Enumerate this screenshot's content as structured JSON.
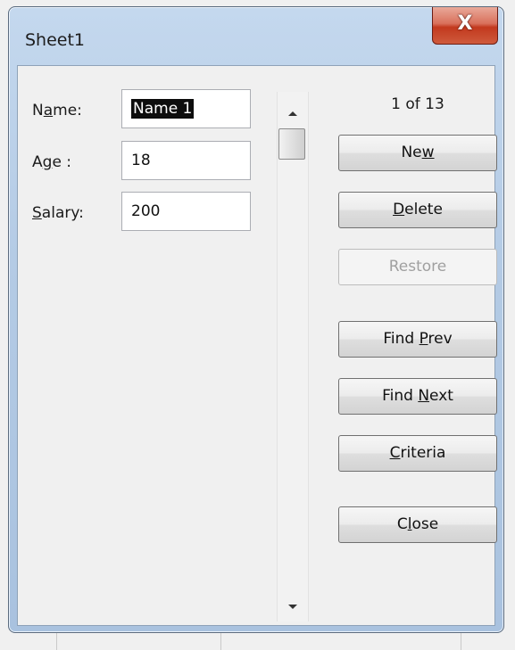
{
  "window": {
    "title": "Sheet1",
    "close_glyph": "X"
  },
  "fields": [
    {
      "label_pre": "N",
      "label_key": "a",
      "label_post": "me:",
      "value": "Name 1",
      "selected": true
    },
    {
      "label_pre": "A",
      "label_key": "g",
      "label_post": "e :",
      "value": "18",
      "selected": false
    },
    {
      "label_pre": "",
      "label_key": "S",
      "label_post": "alary:",
      "value": "200",
      "selected": false
    }
  ],
  "record_counter": "1 of 13",
  "buttons": {
    "new": {
      "pre": "Ne",
      "key": "w",
      "post": ""
    },
    "delete": {
      "pre": "",
      "key": "D",
      "post": "elete"
    },
    "restore": {
      "label": "Restore",
      "enabled": false
    },
    "findprev": {
      "pre": "Find ",
      "key": "P",
      "post": "rev"
    },
    "findnext": {
      "pre": "Find ",
      "key": "N",
      "post": "ext"
    },
    "criteria": {
      "pre": "",
      "key": "C",
      "post": "riteria"
    },
    "close": {
      "pre": "C",
      "key": "l",
      "post": "ose"
    }
  },
  "colors": {
    "title_bar": "#b4cbe5",
    "close_button": "#c2391e",
    "dialog_bg": "#f0f0f0",
    "selection": "#0d0d0d"
  }
}
